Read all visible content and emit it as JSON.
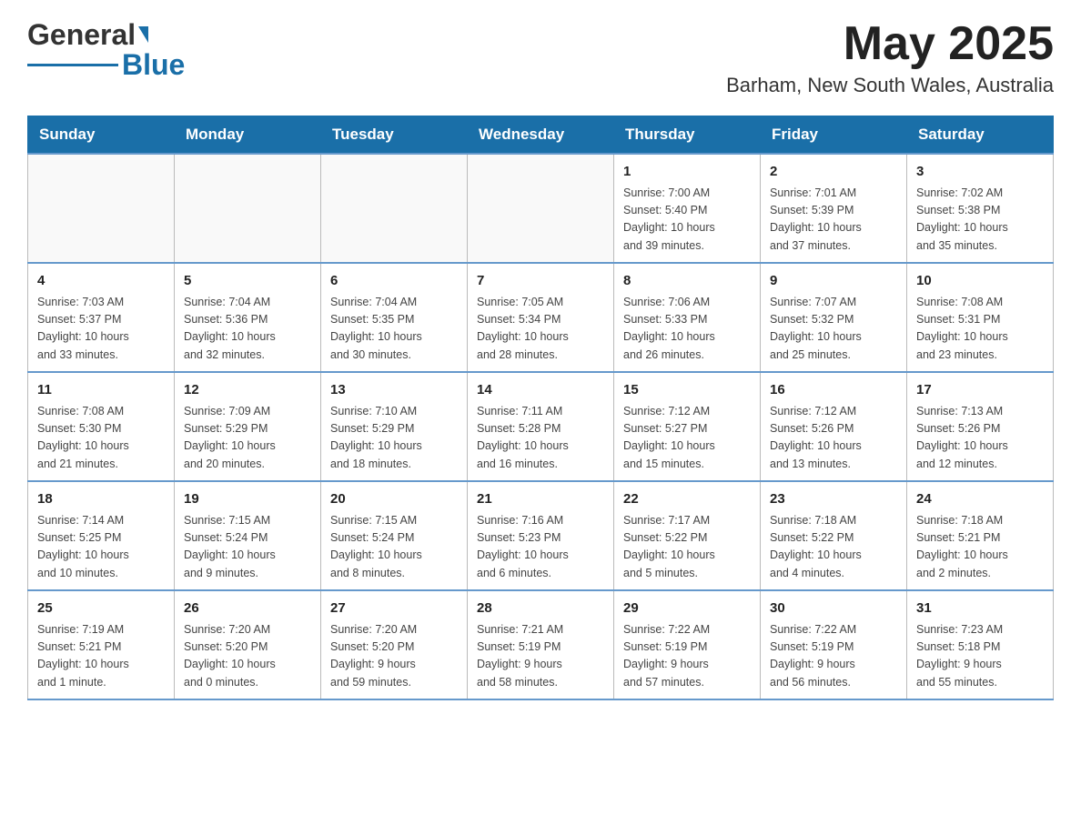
{
  "header": {
    "logo_general": "General",
    "logo_blue": "Blue",
    "month_title": "May 2025",
    "location": "Barham, New South Wales, Australia"
  },
  "weekdays": [
    "Sunday",
    "Monday",
    "Tuesday",
    "Wednesday",
    "Thursday",
    "Friday",
    "Saturday"
  ],
  "weeks": [
    [
      {
        "day": "",
        "info": ""
      },
      {
        "day": "",
        "info": ""
      },
      {
        "day": "",
        "info": ""
      },
      {
        "day": "",
        "info": ""
      },
      {
        "day": "1",
        "info": "Sunrise: 7:00 AM\nSunset: 5:40 PM\nDaylight: 10 hours\nand 39 minutes."
      },
      {
        "day": "2",
        "info": "Sunrise: 7:01 AM\nSunset: 5:39 PM\nDaylight: 10 hours\nand 37 minutes."
      },
      {
        "day": "3",
        "info": "Sunrise: 7:02 AM\nSunset: 5:38 PM\nDaylight: 10 hours\nand 35 minutes."
      }
    ],
    [
      {
        "day": "4",
        "info": "Sunrise: 7:03 AM\nSunset: 5:37 PM\nDaylight: 10 hours\nand 33 minutes."
      },
      {
        "day": "5",
        "info": "Sunrise: 7:04 AM\nSunset: 5:36 PM\nDaylight: 10 hours\nand 32 minutes."
      },
      {
        "day": "6",
        "info": "Sunrise: 7:04 AM\nSunset: 5:35 PM\nDaylight: 10 hours\nand 30 minutes."
      },
      {
        "day": "7",
        "info": "Sunrise: 7:05 AM\nSunset: 5:34 PM\nDaylight: 10 hours\nand 28 minutes."
      },
      {
        "day": "8",
        "info": "Sunrise: 7:06 AM\nSunset: 5:33 PM\nDaylight: 10 hours\nand 26 minutes."
      },
      {
        "day": "9",
        "info": "Sunrise: 7:07 AM\nSunset: 5:32 PM\nDaylight: 10 hours\nand 25 minutes."
      },
      {
        "day": "10",
        "info": "Sunrise: 7:08 AM\nSunset: 5:31 PM\nDaylight: 10 hours\nand 23 minutes."
      }
    ],
    [
      {
        "day": "11",
        "info": "Sunrise: 7:08 AM\nSunset: 5:30 PM\nDaylight: 10 hours\nand 21 minutes."
      },
      {
        "day": "12",
        "info": "Sunrise: 7:09 AM\nSunset: 5:29 PM\nDaylight: 10 hours\nand 20 minutes."
      },
      {
        "day": "13",
        "info": "Sunrise: 7:10 AM\nSunset: 5:29 PM\nDaylight: 10 hours\nand 18 minutes."
      },
      {
        "day": "14",
        "info": "Sunrise: 7:11 AM\nSunset: 5:28 PM\nDaylight: 10 hours\nand 16 minutes."
      },
      {
        "day": "15",
        "info": "Sunrise: 7:12 AM\nSunset: 5:27 PM\nDaylight: 10 hours\nand 15 minutes."
      },
      {
        "day": "16",
        "info": "Sunrise: 7:12 AM\nSunset: 5:26 PM\nDaylight: 10 hours\nand 13 minutes."
      },
      {
        "day": "17",
        "info": "Sunrise: 7:13 AM\nSunset: 5:26 PM\nDaylight: 10 hours\nand 12 minutes."
      }
    ],
    [
      {
        "day": "18",
        "info": "Sunrise: 7:14 AM\nSunset: 5:25 PM\nDaylight: 10 hours\nand 10 minutes."
      },
      {
        "day": "19",
        "info": "Sunrise: 7:15 AM\nSunset: 5:24 PM\nDaylight: 10 hours\nand 9 minutes."
      },
      {
        "day": "20",
        "info": "Sunrise: 7:15 AM\nSunset: 5:24 PM\nDaylight: 10 hours\nand 8 minutes."
      },
      {
        "day": "21",
        "info": "Sunrise: 7:16 AM\nSunset: 5:23 PM\nDaylight: 10 hours\nand 6 minutes."
      },
      {
        "day": "22",
        "info": "Sunrise: 7:17 AM\nSunset: 5:22 PM\nDaylight: 10 hours\nand 5 minutes."
      },
      {
        "day": "23",
        "info": "Sunrise: 7:18 AM\nSunset: 5:22 PM\nDaylight: 10 hours\nand 4 minutes."
      },
      {
        "day": "24",
        "info": "Sunrise: 7:18 AM\nSunset: 5:21 PM\nDaylight: 10 hours\nand 2 minutes."
      }
    ],
    [
      {
        "day": "25",
        "info": "Sunrise: 7:19 AM\nSunset: 5:21 PM\nDaylight: 10 hours\nand 1 minute."
      },
      {
        "day": "26",
        "info": "Sunrise: 7:20 AM\nSunset: 5:20 PM\nDaylight: 10 hours\nand 0 minutes."
      },
      {
        "day": "27",
        "info": "Sunrise: 7:20 AM\nSunset: 5:20 PM\nDaylight: 9 hours\nand 59 minutes."
      },
      {
        "day": "28",
        "info": "Sunrise: 7:21 AM\nSunset: 5:19 PM\nDaylight: 9 hours\nand 58 minutes."
      },
      {
        "day": "29",
        "info": "Sunrise: 7:22 AM\nSunset: 5:19 PM\nDaylight: 9 hours\nand 57 minutes."
      },
      {
        "day": "30",
        "info": "Sunrise: 7:22 AM\nSunset: 5:19 PM\nDaylight: 9 hours\nand 56 minutes."
      },
      {
        "day": "31",
        "info": "Sunrise: 7:23 AM\nSunset: 5:18 PM\nDaylight: 9 hours\nand 55 minutes."
      }
    ]
  ]
}
